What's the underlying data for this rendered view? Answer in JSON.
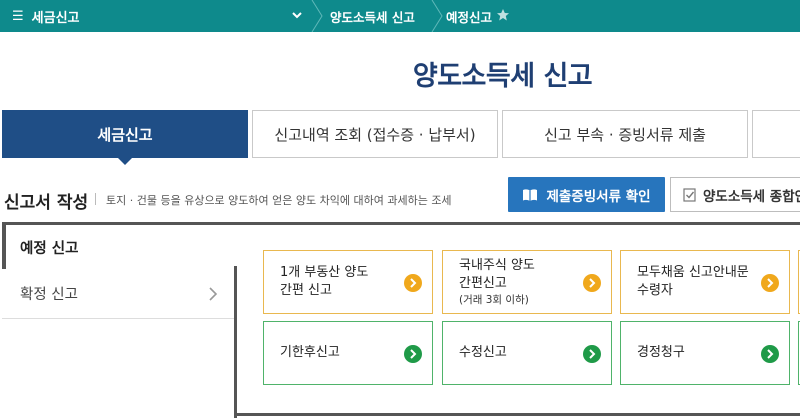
{
  "topbar": {
    "menu_label": "세금신고",
    "crumb1": "양도소득세 신고",
    "crumb2": "예정신고"
  },
  "page_title": "양도소득세  신고",
  "tabs": [
    {
      "label": "세금신고",
      "active": true
    },
    {
      "label": "신고내역 조회 (접수증 · 납부서)",
      "active": false
    },
    {
      "label": "신고 부속 · 증빙서류 제출",
      "active": false
    },
    {
      "label": "",
      "active": false
    }
  ],
  "section": {
    "title": "신고서 작성",
    "description": "토지 · 건물 등을 유상으로 양도하여 얻은 양도 차익에 대하여 과세하는 조세",
    "btn_primary": "제출증빙서류 확인",
    "btn_outline": "양도소득세 종합안"
  },
  "side_menu": [
    {
      "label": "예정 신고",
      "selected": true
    },
    {
      "label": "확정 신고",
      "selected": false
    }
  ],
  "cards": [
    {
      "label": "1개 부동산 양도\n간편 신고",
      "sub": "",
      "color": "orange"
    },
    {
      "label": "국내주식 양도\n간편신고",
      "sub": "(거래 3회 이하)",
      "color": "orange"
    },
    {
      "label": "모두채움 신고안내문\n수령자",
      "sub": "",
      "color": "orange"
    },
    {
      "label": "기한후신고",
      "sub": "",
      "color": "green"
    },
    {
      "label": "수정신고",
      "sub": "",
      "color": "green"
    },
    {
      "label": "경정청구",
      "sub": "",
      "color": "green"
    }
  ],
  "colors": {
    "topbar": "#0e8a8c",
    "title": "#1f3f73",
    "active_tab": "#1f4e86",
    "primary_button": "#2775bd",
    "orange_accent": "#f0a81c",
    "green_accent": "#1f9a48"
  }
}
